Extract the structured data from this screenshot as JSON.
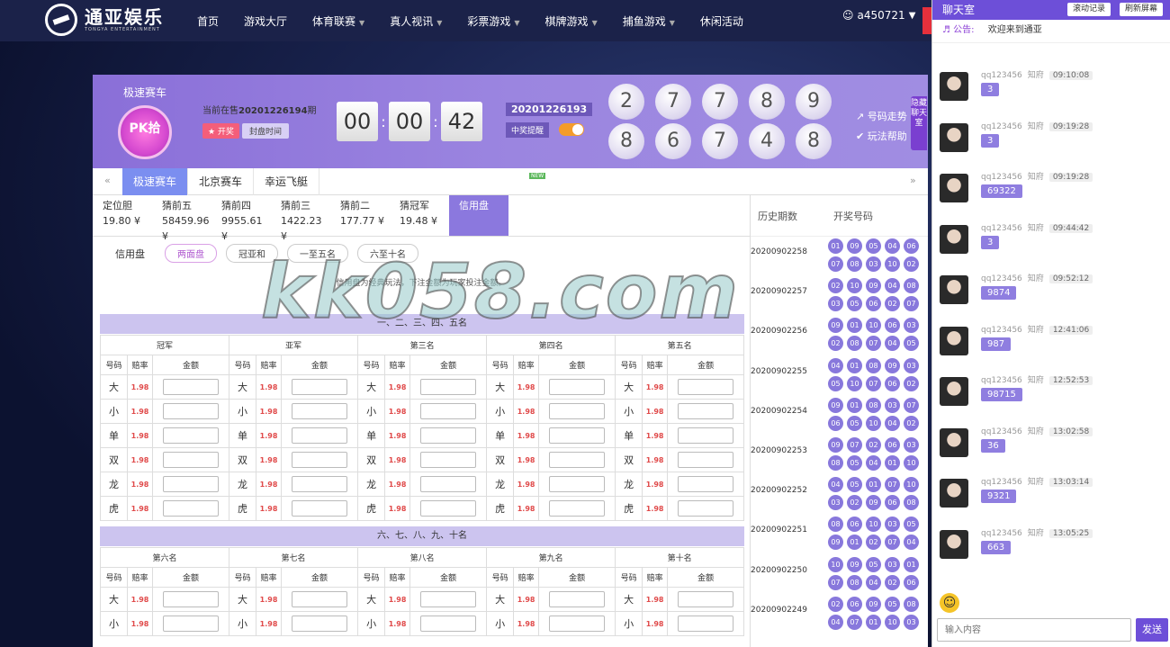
{
  "nav": {
    "logo_cn": "通亚娱乐",
    "logo_en": "TONGYA ENTERTAINMENT",
    "items": [
      "首页",
      "游戏大厅",
      "体育联赛",
      "真人视讯",
      "彩票游戏",
      "棋牌游戏",
      "捕鱼游戏",
      "休闲活动"
    ],
    "username": "a450721"
  },
  "game": {
    "name": "极速赛车",
    "icon_text": "PK拾",
    "current_prefix": "当前在售",
    "current_issue": "20201226194",
    "current_suffix": "期",
    "btn_open": "★ 开奖",
    "btn_close": "封盘时间",
    "timer": [
      "00",
      "00",
      "42"
    ],
    "last_issue": "20201226193",
    "win_alert": "中奖提醒",
    "balls": [
      "2",
      "7",
      "7",
      "8",
      "9",
      "8",
      "6",
      "7",
      "4",
      "8"
    ],
    "link_trend": "号码走势",
    "link_rules": "玩法帮助",
    "hide_chat": "隐藏聊天室"
  },
  "tabs": [
    "极速赛车",
    "北京赛车",
    "幸运飞艇"
  ],
  "new_badge": "NEW",
  "odds": [
    {
      "name": "定位胆",
      "value": "19.80 ¥"
    },
    {
      "name": "猜前五",
      "value": "58459.96 ¥"
    },
    {
      "name": "猜前四",
      "value": "9955.61 ¥"
    },
    {
      "name": "猜前三",
      "value": "1422.23 ¥"
    },
    {
      "name": "猜前二",
      "value": "177.77 ¥"
    },
    {
      "name": "猜冠军",
      "value": "19.48 ¥"
    },
    {
      "name": "信用盘",
      "value": ""
    }
  ],
  "filters": {
    "label": "信用盘",
    "items": [
      "两面盘",
      "冠亚和",
      "一至五名",
      "六至十名"
    ]
  },
  "notice": "信用盘为经典玩法，下注金额为玩家投注金额。",
  "section1": "一、二、三、四、五名",
  "section2": "六、七、八、九、十名",
  "cols1": [
    "冠军",
    "亚军",
    "第三名",
    "第四名",
    "第五名"
  ],
  "cols2": [
    "第六名",
    "第七名",
    "第八名",
    "第九名",
    "第十名"
  ],
  "sub": {
    "num": "号码",
    "rate": "赔率",
    "amt": "金额"
  },
  "bet_rows": [
    {
      "label": "大",
      "odd": "1.98"
    },
    {
      "label": "小",
      "odd": "1.98"
    },
    {
      "label": "单",
      "odd": "1.98"
    },
    {
      "label": "双",
      "odd": "1.98"
    },
    {
      "label": "龙",
      "odd": "1.98"
    },
    {
      "label": "虎",
      "odd": "1.98"
    }
  ],
  "history": {
    "head_issue": "历史期数",
    "head_nums": "开奖号码",
    "rows": [
      {
        "issue": "20200902258",
        "nums": [
          "01",
          "09",
          "05",
          "04",
          "06",
          "07",
          "08",
          "03",
          "10",
          "02"
        ]
      },
      {
        "issue": "20200902257",
        "nums": [
          "02",
          "10",
          "09",
          "04",
          "08",
          "03",
          "05",
          "06",
          "02",
          "07"
        ]
      },
      {
        "issue": "20200902256",
        "nums": [
          "09",
          "01",
          "10",
          "06",
          "03",
          "02",
          "08",
          "07",
          "04",
          "05"
        ]
      },
      {
        "issue": "20200902255",
        "nums": [
          "04",
          "01",
          "08",
          "09",
          "03",
          "05",
          "10",
          "07",
          "06",
          "02"
        ]
      },
      {
        "issue": "20200902254",
        "nums": [
          "09",
          "01",
          "08",
          "03",
          "07",
          "06",
          "05",
          "10",
          "04",
          "02"
        ]
      },
      {
        "issue": "20200902253",
        "nums": [
          "09",
          "07",
          "02",
          "06",
          "03",
          "08",
          "05",
          "04",
          "01",
          "10"
        ]
      },
      {
        "issue": "20200902252",
        "nums": [
          "04",
          "05",
          "01",
          "07",
          "10",
          "03",
          "02",
          "09",
          "06",
          "08"
        ]
      },
      {
        "issue": "20200902251",
        "nums": [
          "08",
          "06",
          "10",
          "03",
          "05",
          "09",
          "01",
          "02",
          "07",
          "04"
        ]
      },
      {
        "issue": "20200902250",
        "nums": [
          "10",
          "09",
          "05",
          "03",
          "01",
          "07",
          "08",
          "04",
          "02",
          "06"
        ]
      },
      {
        "issue": "20200902249",
        "nums": [
          "02",
          "06",
          "09",
          "05",
          "08",
          "04",
          "07",
          "01",
          "10",
          "03"
        ]
      }
    ]
  },
  "chat": {
    "title": "聊天室",
    "btn_scroll": "滚动记录",
    "btn_refresh": "刷新屏幕",
    "announce_label": "公告:",
    "announce_text": "欢迎来到通亚",
    "messages": [
      {
        "user": "qq123456",
        "role": "知府",
        "time": "09:10:08",
        "text": "3"
      },
      {
        "user": "qq123456",
        "role": "知府",
        "time": "09:19:28",
        "text": "3"
      },
      {
        "user": "qq123456",
        "role": "知府",
        "time": "09:19:28",
        "text": "69322"
      },
      {
        "user": "qq123456",
        "role": "知府",
        "time": "09:44:42",
        "text": "3"
      },
      {
        "user": "qq123456",
        "role": "知府",
        "time": "09:52:12",
        "text": "9874"
      },
      {
        "user": "qq123456",
        "role": "知府",
        "time": "12:41:06",
        "text": "987"
      },
      {
        "user": "qq123456",
        "role": "知府",
        "time": "12:52:53",
        "text": "98715"
      },
      {
        "user": "qq123456",
        "role": "知府",
        "time": "13:02:58",
        "text": "36"
      },
      {
        "user": "qq123456",
        "role": "知府",
        "time": "13:03:14",
        "text": "9321"
      },
      {
        "user": "qq123456",
        "role": "知府",
        "time": "13:05:25",
        "text": "663"
      }
    ],
    "input_placeholder": "输入内容",
    "send": "发送"
  },
  "watermark": "kk058.com"
}
